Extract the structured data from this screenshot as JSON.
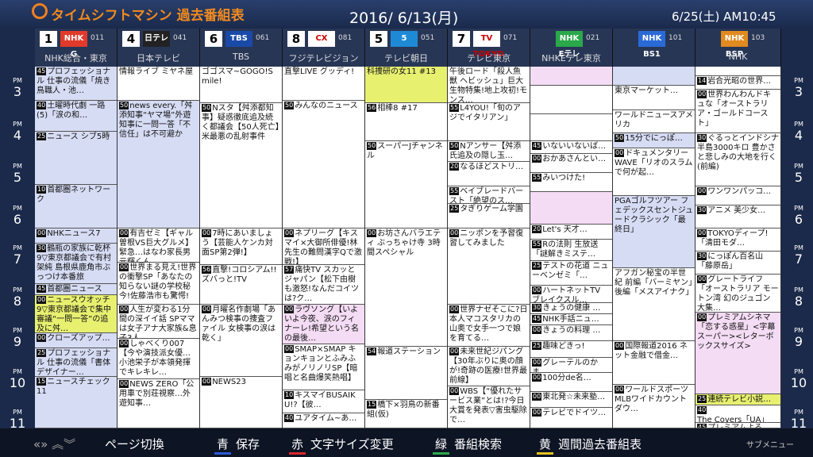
{
  "header": {
    "title": "タイムシフトマシン 過去番組表",
    "date": "2016/ 6/13(月)",
    "now": "6/25(土) AM10:45"
  },
  "channels": [
    {
      "num": "1",
      "logo": "NHK G",
      "code": "011",
      "name": "NHK総合・東京",
      "logo_color": "#e23a2a"
    },
    {
      "num": "4",
      "logo": "日テレ",
      "code": "041",
      "name": "日本テレビ",
      "logo_color": "#222222"
    },
    {
      "num": "6",
      "logo": "TBS",
      "code": "061",
      "name": "TBS",
      "logo_color": "#1a4aa8"
    },
    {
      "num": "8",
      "logo": "CX",
      "code": "081",
      "name": "フジテレビジョン",
      "logo_color": "#ffffff"
    },
    {
      "num": "5",
      "logo": "5",
      "code": "051",
      "name": "テレビ朝日",
      "logo_color": "#1e8ad6"
    },
    {
      "num": "7",
      "logo": "TV TOKYO",
      "code": "071",
      "name": "テレビ東京",
      "logo_color": "#ffffff"
    },
    {
      "num": "",
      "logo": "NHK Eテレ",
      "code": "021",
      "name": "NHKEテレ東京",
      "logo_color": "#2aa84a"
    },
    {
      "num": "",
      "logo": "NHK BS1",
      "code": "101",
      "name": "",
      "logo_color": "#2a6ad6"
    },
    {
      "num": "",
      "logo": "NHK BSP",
      "code": "103",
      "name": "NHK",
      "logo_color": "#e08a20"
    }
  ],
  "times": [
    "3",
    "4",
    "5",
    "6",
    "7",
    "8",
    "9",
    "10",
    "11"
  ],
  "time_pm": "PM",
  "programs": [
    [
      {
        "m": "45",
        "t": "プロフェッショナル 仕事の流儀「焼き鳥職人・池…",
        "s": 0,
        "h": 3.6,
        "c": "b"
      },
      {
        "m": "40",
        "t": "土曜時代劇 一路(5)「涙の和…",
        "s": 3.6,
        "h": 3.2,
        "c": "b"
      },
      {
        "m": "25",
        "t": "ニュース シブ5時",
        "s": 6.8,
        "h": 5.6,
        "c": "b"
      },
      {
        "m": "10",
        "t": "首都圏ネットワーク",
        "s": 12.4,
        "h": 4.6,
        "c": "b"
      },
      {
        "m": "00",
        "t": "NHKニュース7",
        "s": 17,
        "h": 1.6,
        "c": "b"
      },
      {
        "m": "30",
        "t": "鶴瓶の家族に乾杯 9▽東京都議会で有村架純 島根県鹿角市ぶっつけ本番旅",
        "s": 18.6,
        "h": 4.2,
        "c": "b"
      },
      {
        "m": "45",
        "t": "首都圏ニュース",
        "s": 22.8,
        "h": 1.2,
        "c": "b"
      },
      {
        "m": "00",
        "t": "ニュースウオッチ9▽東京都議会で集中審議“一問一答”の追及に舛…",
        "s": 24,
        "h": 4,
        "c": "y"
      },
      {
        "m": "00",
        "t": "クローズアップ…",
        "s": 28,
        "h": 1.6,
        "c": "b"
      },
      {
        "m": "25",
        "t": "プロフェッショナル 仕事の流儀「書体デザイナー…",
        "s": 29.6,
        "h": 3,
        "c": "b"
      },
      {
        "m": "15",
        "t": "ニュースチェック11",
        "s": 32.6,
        "h": 5.4,
        "c": "b"
      }
    ],
    [
      {
        "m": "",
        "t": "情報ライブ ミヤネ屋",
        "s": 0,
        "h": 3.6,
        "c": "w"
      },
      {
        "m": "50",
        "t": "news every.「舛添知事“ヤマ場”外遊知事に一問一答「不信任」は不可避か",
        "s": 3.6,
        "h": 13.4,
        "c": "b"
      },
      {
        "m": "00",
        "t": "有吉ゼミ【ギャル曽根VS巨大グルメ】緊急…はなわ家長男元輝くん…",
        "s": 17,
        "h": 3.6,
        "c": "w"
      },
      {
        "m": "00",
        "t": "世界まる見え!世界の衝撃SP「あなたの知らない謎の学校秘今!佐藤浩市も驚愕!",
        "s": 20.6,
        "h": 4.4,
        "c": "w"
      },
      {
        "m": "00",
        "t": "人生が変わる1分間の深イイ話 SPママは女子アナ大家族&息子3人…",
        "s": 25,
        "h": 3.6,
        "c": "w"
      },
      {
        "m": "00",
        "t": "しゃべくり007【今や演技派女優…小池栄子が本領発揮でキレキレ…",
        "s": 28.6,
        "h": 4.2,
        "c": "w"
      },
      {
        "m": "00",
        "t": "NEWS ZERO「公用車で別荘視察…外遊知事…",
        "s": 32.8,
        "h": 5.2,
        "c": "w"
      }
    ],
    [
      {
        "m": "",
        "t": "ゴゴスマ~GOGO!Smile!",
        "s": 0,
        "h": 3.8,
        "c": "w"
      },
      {
        "m": "50",
        "t": "Nスタ【舛添都知事】疑惑徹底追及続く都議会【50人死亡】米最悪の乱射事件",
        "s": 3.8,
        "h": 13.2,
        "c": "w"
      },
      {
        "m": "00",
        "t": "7時にあいましょう【芸能人ケンカ対面SP第2弾!】",
        "s": 17,
        "h": 3.8,
        "c": "w"
      },
      {
        "m": "56",
        "t": "直撃!コロシアム!!ズバっと!TV",
        "s": 20.8,
        "h": 4.2,
        "c": "w"
      },
      {
        "m": "00",
        "t": "月曜名作劇場「あんみつ検事の捜査ファイル 女検事の涙は乾く」",
        "s": 25,
        "h": 7.6,
        "c": "w"
      },
      {
        "m": "00",
        "t": "NEWS23",
        "s": 32.6,
        "h": 5.4,
        "c": "w"
      }
    ],
    [
      {
        "m": "",
        "t": "直撃LIVE グッディ!",
        "s": 0,
        "h": 3.6,
        "c": "w"
      },
      {
        "m": "50",
        "t": "みんなのニュース",
        "s": 3.6,
        "h": 13.4,
        "c": "w"
      },
      {
        "m": "00",
        "t": "ネプリーグ【キスマイ×大御所俳優!林先生の難問漢字Qで激戦!】",
        "s": 17,
        "h": 3.8,
        "c": "w"
      },
      {
        "m": "57",
        "t": "痛快TV スカッとジャパン【松下由樹も激怒!なんだコイツは?ク…",
        "s": 20.8,
        "h": 4.2,
        "c": "w"
      },
      {
        "m": "00",
        "t": "ラヴソング【いよいよ今夜、涙のフィナーレ!希望という名の最後…",
        "s": 25,
        "h": 4.2,
        "c": "p"
      },
      {
        "m": "00",
        "t": "SMAP×SMAP キョンキョンとふみふみがノリノリSP【暗唱と名曲爆笑熱唱】",
        "s": 29.2,
        "h": 4.8,
        "c": "w"
      },
      {
        "m": "10",
        "t": "キスマイBUSAIKU!?【彼…",
        "s": 34,
        "h": 2.4,
        "c": "w"
      },
      {
        "m": "40",
        "t": "ユアタイム~あ…",
        "s": 36.4,
        "h": 1.6,
        "c": "w"
      }
    ],
    [
      {
        "m": "",
        "t": "科捜研の女11 #13",
        "s": 0,
        "h": 3.8,
        "c": "y"
      },
      {
        "m": "56",
        "t": "相棒8 #17",
        "s": 3.8,
        "h": 4,
        "c": "w"
      },
      {
        "m": "50",
        "t": "スーパーJチャンネル",
        "s": 7.8,
        "h": 9.2,
        "c": "w"
      },
      {
        "m": "00",
        "t": "お坊さんバラエティ ぶっちゃけ寺 3時間スペシャル",
        "s": 17,
        "h": 12.4,
        "c": "w"
      },
      {
        "m": "54",
        "t": "報道ステーション",
        "s": 29.4,
        "h": 5.6,
        "c": "w"
      },
      {
        "m": "15",
        "t": "橋下×羽鳥の新番組(仮)",
        "s": 35,
        "h": 3,
        "c": "w"
      }
    ],
    [
      {
        "m": "",
        "t": "午後ロード「殺人魚獣 ヘビッシュ」巨大生物特集!地上攻初!モンス…",
        "s": 0,
        "h": 3.8,
        "c": "w"
      },
      {
        "m": "55",
        "t": "L4YOU!「旬のアジでイタリアン」",
        "s": 3.8,
        "h": 4,
        "c": "w"
      },
      {
        "m": "50",
        "t": "Nアンサー【舛添氏追及の隠し玉…",
        "s": 7.8,
        "h": 2.2,
        "c": "w"
      },
      {
        "m": "20",
        "t": "なるほどストリ…",
        "s": 10,
        "h": 2.6,
        "c": "w"
      },
      {
        "m": "55",
        "t": "ベイブレードバースト「絶望のス…",
        "s": 12.6,
        "h": 1.8,
        "c": "w"
      },
      {
        "m": "25",
        "t": "タぎりゲーム学園",
        "s": 14.4,
        "h": 2.6,
        "c": "w"
      },
      {
        "m": "00",
        "t": "ニッポンを予習復習してみました",
        "s": 17,
        "h": 8,
        "c": "w"
      },
      {
        "m": "00",
        "t": "世界ナゼそこに?日本人マコスタリカの山奥で女手一つで娘を育てる…",
        "s": 25,
        "h": 4.4,
        "c": "w"
      },
      {
        "m": "00",
        "t": "未来世紀ジパング【30年ぶりに奥の顔が!奇跡の医療!世界最前線】",
        "s": 29.4,
        "h": 4.2,
        "c": "w"
      },
      {
        "m": "00",
        "t": "WBS【“優れたサービス業”とは!?今日大賞を発表▽害虫駆除で…",
        "s": 33.6,
        "h": 4.4,
        "c": "w"
      }
    ],
    [
      {
        "m": "",
        "t": "",
        "s": 0,
        "h": 2,
        "c": "p"
      },
      {
        "m": "",
        "t": "",
        "s": 2,
        "h": 3,
        "c": "w"
      },
      {
        "m": "",
        "t": "",
        "s": 5,
        "h": 2.8,
        "c": "w"
      },
      {
        "m": "45",
        "t": "いないいないば…",
        "s": 7.8,
        "h": 1.4,
        "c": "w"
      },
      {
        "m": "00",
        "t": "おかあさんとい…",
        "s": 9.2,
        "h": 2,
        "c": "w"
      },
      {
        "m": "55",
        "t": "みいつけた!",
        "s": 11.2,
        "h": 2,
        "c": "w"
      },
      {
        "m": "",
        "t": "",
        "s": 13.2,
        "h": 3.4,
        "c": "p"
      },
      {
        "m": "20",
        "t": "Let's 天才…",
        "s": 16.6,
        "h": 1.6,
        "c": "w"
      },
      {
        "m": "55",
        "t": "Rの法則 生放送「謎解きミステ…",
        "s": 18.2,
        "h": 2.2,
        "c": "w"
      },
      {
        "m": "25",
        "t": "テストの花道 ニューベンゼミ「…",
        "s": 20.4,
        "h": 2.6,
        "c": "w"
      },
      {
        "m": "00",
        "t": "ハートネットTV ブレイクスル…",
        "s": 23,
        "h": 1.8,
        "c": "w"
      },
      {
        "m": "30",
        "t": "きょうの健康 …",
        "s": 24.8,
        "h": 1.2,
        "c": "w"
      },
      {
        "m": "45",
        "t": "NHK手話ニュ…",
        "s": 26,
        "h": 1.2,
        "c": "w"
      },
      {
        "m": "00",
        "t": "きょうの料理 …",
        "s": 27.2,
        "h": 1.6,
        "c": "w"
      },
      {
        "m": "25",
        "t": "趣味どきっ!",
        "s": 28.8,
        "h": 1.8,
        "c": "w"
      },
      {
        "m": "00",
        "t": "グレーテルのかま…",
        "s": 30.6,
        "h": 1.6,
        "c": "w"
      },
      {
        "m": "00",
        "t": "100分de名…",
        "s": 32.2,
        "h": 2,
        "c": "w"
      },
      {
        "m": "00",
        "t": "東北発☆未来塾…",
        "s": 34.2,
        "h": 1.6,
        "c": "w"
      },
      {
        "m": "00",
        "t": "テレビでドイツ…",
        "s": 35.8,
        "h": 2.2,
        "c": "w"
      }
    ],
    [
      {
        "m": "",
        "t": "",
        "s": 0,
        "h": 2,
        "c": "b"
      },
      {
        "m": "",
        "t": "東京マーケット…",
        "s": 2,
        "h": 2.6,
        "c": "w"
      },
      {
        "m": "",
        "t": "ワールドニュースアメリカ",
        "s": 4.6,
        "h": 2.4,
        "c": "w"
      },
      {
        "m": "50",
        "t": "15分でにっぽ…",
        "s": 7,
        "h": 1.6,
        "c": "b"
      },
      {
        "m": "00",
        "t": "ドキュメンタリーWAVE「リオのスラムで何が起…",
        "s": 8.6,
        "h": 5,
        "c": "w"
      },
      {
        "m": "",
        "t": "PGAゴルフツアー フェデックスセントジュードクラシック「最終日」",
        "s": 13.6,
        "h": 7.6,
        "c": "b"
      },
      {
        "m": "",
        "t": "アフガン秘宝の半世紀 前編「バーミヤン」後編「メスアイナク」",
        "s": 21.2,
        "h": 7.6,
        "c": "w"
      },
      {
        "m": "00",
        "t": "国際報道2016 ネット金融で借金…",
        "s": 28.8,
        "h": 4.6,
        "c": "w"
      },
      {
        "m": "00",
        "t": "ワールドスポーツMLBワイドカウントダウ…",
        "s": 33.4,
        "h": 4.6,
        "c": "w"
      }
    ],
    [
      {
        "m": "",
        "t": "",
        "s": 0,
        "h": 1,
        "c": "w"
      },
      {
        "m": "14",
        "t": "岩合光昭の世界…",
        "s": 1,
        "h": 1.4,
        "c": "w"
      },
      {
        "m": "00",
        "t": "世界わんわんドキュな「オーストラリア・ゴールドコースト」",
        "s": 2.4,
        "h": 4.6,
        "c": "w"
      },
      {
        "m": "30",
        "t": "ぐるっとインドシナ半島3000キロ 豊かさと悲しみの大地を行く(前編)",
        "s": 7,
        "h": 5.6,
        "c": "w"
      },
      {
        "m": "00",
        "t": "ワンワンパッコ…",
        "s": 12.6,
        "h": 2,
        "c": "w"
      },
      {
        "m": "30",
        "t": "アニメ 美少女…",
        "s": 14.6,
        "h": 2.4,
        "c": "w"
      },
      {
        "m": "00",
        "t": "TOKYOディープ!「清田モダ…",
        "s": 17,
        "h": 2.4,
        "c": "w"
      },
      {
        "m": "30",
        "t": "にっぽん百名山「藤原岳」",
        "s": 19.4,
        "h": 2.4,
        "c": "w"
      },
      {
        "m": "00",
        "t": "グレートライフ「オーストラリア モートン湾 幻のジュゴン 大集…",
        "s": 21.8,
        "h": 4,
        "c": "w"
      },
      {
        "m": "00",
        "t": "プレミアムシネマ「恋する惑星」<字幕スーパー><レターボックスサイズ>",
        "s": 25.8,
        "h": 8.6,
        "c": "p"
      },
      {
        "m": "25",
        "t": "連続テレビ小説…",
        "s": 34.4,
        "h": 1.2,
        "c": "y"
      },
      {
        "m": "40",
        "t": "The Covers「UA」",
        "s": 35.6,
        "h": 1.8,
        "c": "w"
      },
      {
        "m": "45",
        "t": "プレミアムよる…",
        "s": 37.4,
        "h": 0.6,
        "c": "w"
      }
    ]
  ],
  "footer": {
    "page_arrows": "«» ︽︾",
    "page_label": "ページ切換",
    "blue_key": "青",
    "blue_label": "保存",
    "red_key": "赤",
    "red_label": "文字サイズ変更",
    "green_key": "緑",
    "green_label": "番組検索",
    "yellow_key": "黄",
    "yellow_label": "週間過去番組表",
    "corner": "サブメニュー"
  },
  "colors": {
    "blue": "#2a5ad6",
    "red": "#d62a2a",
    "green": "#2aa84a",
    "yellow": "#e0c020"
  }
}
